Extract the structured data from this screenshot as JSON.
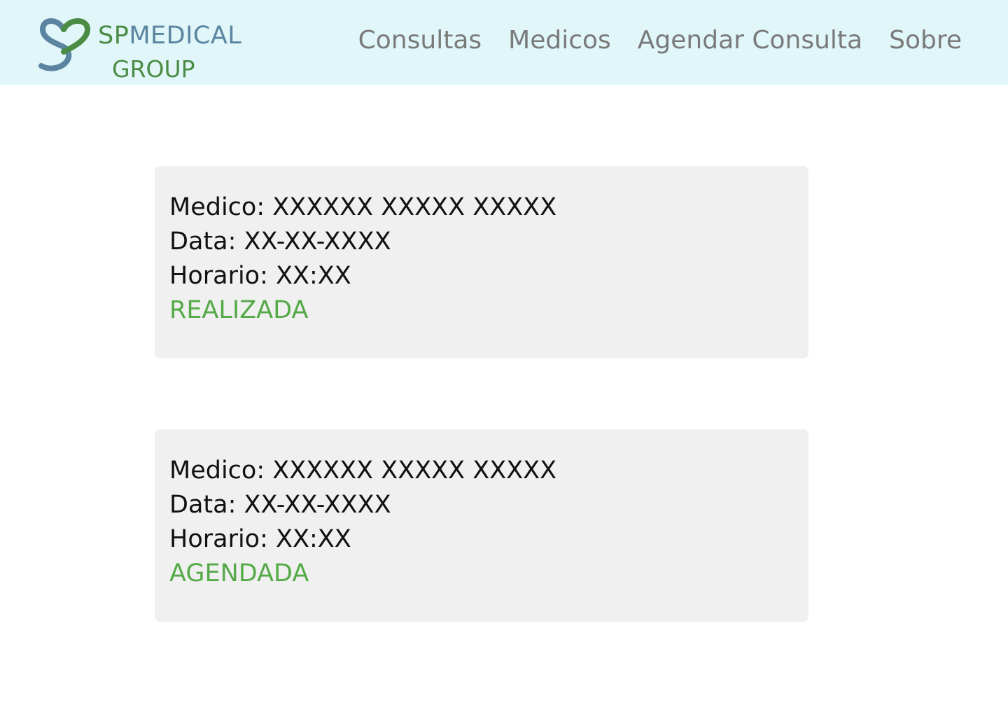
{
  "brand": {
    "name_part1": "SP",
    "name_part2": "MEDICAL",
    "name_line2": "GROUP",
    "icon": "heart-s-logo-icon",
    "colors": {
      "green": "#4b8c45",
      "blue": "#5a84a0",
      "header_bg": "#e0f6f8"
    }
  },
  "nav": {
    "items": [
      {
        "label": "Consultas"
      },
      {
        "label": "Medicos"
      },
      {
        "label": "Agendar Consulta"
      },
      {
        "label": "Sobre"
      }
    ]
  },
  "appointments": [
    {
      "medico_label": "Medico: XXXXXX XXXXX XXXXX",
      "data_label": "Data: XX-XX-XXXX",
      "horario_label": "Horario: XX:XX",
      "status": "REALIZADA",
      "status_color": "#55aa48"
    },
    {
      "medico_label": "Medico: XXXXXX XXXXX XXXXX",
      "data_label": "Data: XX-XX-XXXX",
      "horario_label": "Horario: XX:XX",
      "status": "AGENDADA",
      "status_color": "#55aa48"
    }
  ]
}
